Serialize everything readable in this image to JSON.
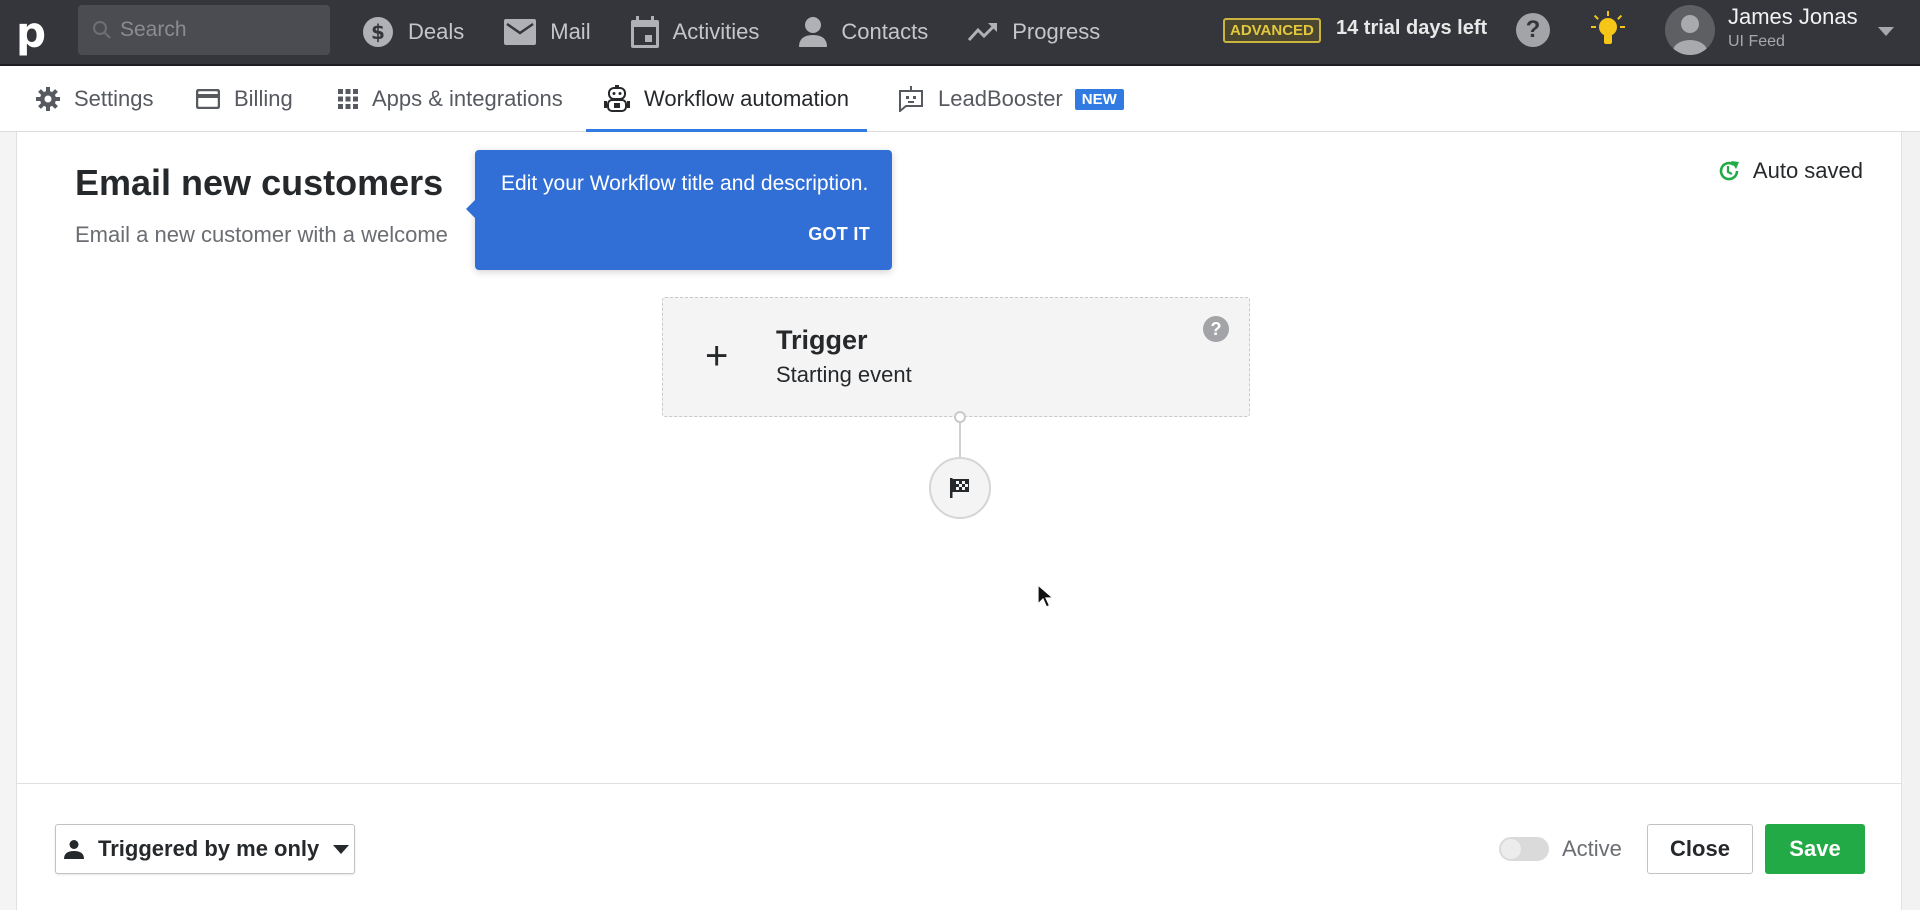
{
  "topbar": {
    "logo": "p",
    "search_placeholder": "Search",
    "nav": [
      {
        "label": "Deals",
        "icon": "dollar-icon"
      },
      {
        "label": "Mail",
        "icon": "mail-icon"
      },
      {
        "label": "Activities",
        "icon": "calendar-icon"
      },
      {
        "label": "Contacts",
        "icon": "person-icon"
      },
      {
        "label": "Progress",
        "icon": "trend-icon"
      }
    ],
    "plan_badge": "ADVANCED",
    "trial_text": "14 trial days left",
    "help_label": "?",
    "user": {
      "name": "James Jonas",
      "company": "UI Feed"
    }
  },
  "subnav": {
    "tabs": [
      {
        "label": "Settings",
        "icon": "gear-icon"
      },
      {
        "label": "Billing",
        "icon": "card-icon"
      },
      {
        "label": "Apps & integrations",
        "icon": "grid-icon"
      },
      {
        "label": "Workflow automation",
        "icon": "robot-icon",
        "active": true
      },
      {
        "label": "LeadBooster",
        "icon": "chatbot-icon",
        "badge": "NEW"
      }
    ]
  },
  "workflow": {
    "title": "Email new customers",
    "description": "Email a new customer with a welcome",
    "autosave_status": "Auto saved",
    "tooltip": {
      "text": "Edit your Workflow title and description.",
      "button": "GOT IT"
    },
    "trigger": {
      "plus": "+",
      "title": "Trigger",
      "subtitle": "Starting event",
      "help": "?"
    }
  },
  "footer": {
    "visibility": "Triggered by me only",
    "active_label": "Active",
    "active": false,
    "close_label": "Close",
    "save_label": "Save"
  },
  "colors": {
    "accent": "#317ae2",
    "save": "#21aa45",
    "autosave": "#21aa45",
    "plan_badge": "#e2c83e",
    "topbar": "#34363b"
  }
}
